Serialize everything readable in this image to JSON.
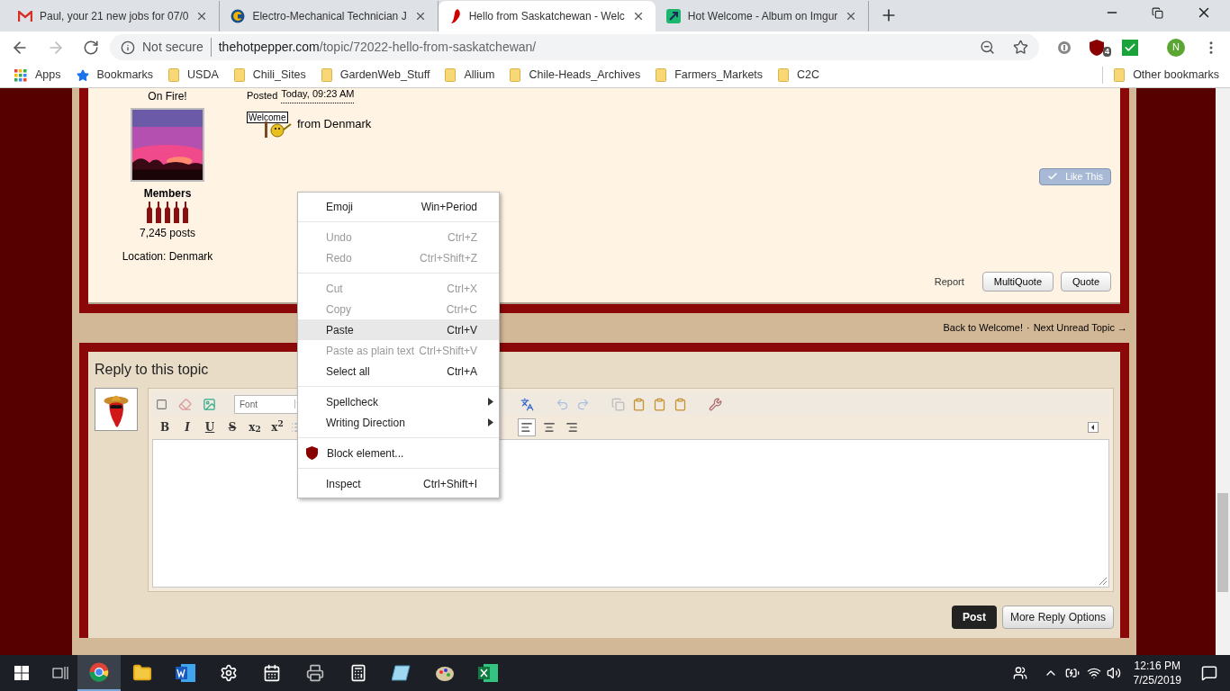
{
  "browser": {
    "tabs": [
      {
        "title": "Paul, your 21 new jobs for 07/0",
        "selected": false
      },
      {
        "title": "Electro-Mechanical Technician J",
        "selected": false
      },
      {
        "title": "Hello from Saskatchewan - Welc",
        "selected": true
      },
      {
        "title": "Hot Welcome - Album on Imgur",
        "selected": false
      }
    ],
    "security": "Not secure",
    "host": "thehotpepper.com",
    "path": "/topic/72022-hello-from-saskatchewan/",
    "extension_badge": "4",
    "profile": "N",
    "bookmarks": [
      {
        "label": "Apps",
        "kind": "apps"
      },
      {
        "label": "Bookmarks",
        "kind": "star"
      },
      {
        "label": "USDA",
        "kind": "folder"
      },
      {
        "label": "Chili_Sites",
        "kind": "folder"
      },
      {
        "label": "GardenWeb_Stuff",
        "kind": "folder"
      },
      {
        "label": "Allium",
        "kind": "folder"
      },
      {
        "label": "Chile-Heads_Archives",
        "kind": "folder"
      },
      {
        "label": "Farmers_Markets",
        "kind": "folder"
      },
      {
        "label": "C2C",
        "kind": "folder"
      }
    ],
    "other_bookmarks": "Other bookmarks"
  },
  "post": {
    "rank": "On Fire!",
    "group": "Members",
    "post_count": "7,245 posts",
    "location": "Location: Denmark",
    "posted_label": "Posted",
    "posted_time": "Today, 09:23 AM",
    "sign": "Welcome",
    "body": "from Denmark",
    "like": "Like This",
    "report": "Report",
    "multiquote": "MultiQuote",
    "quote": "Quote"
  },
  "topic_nav": {
    "back": "Back to Welcome!",
    "separator": "·",
    "next": "Next Unread Topic →"
  },
  "reply": {
    "title": "Reply to this topic",
    "font": "Font",
    "format_buttons": [
      "B",
      "I",
      "U",
      "S",
      "x$_{2}$",
      "x$^{2}$"
    ],
    "align": [
      {
        "selected": true
      },
      {
        "selected": false
      },
      {
        "selected": false
      }
    ],
    "post": "Post",
    "more": "More Reply Options"
  },
  "context_menu": [
    {
      "kind": "item",
      "label": "Emoji",
      "shortcut": "Win+Period",
      "disabled": false,
      "selected": false
    },
    {
      "kind": "separator"
    },
    {
      "kind": "item",
      "label": "Undo",
      "shortcut": "Ctrl+Z",
      "disabled": true,
      "selected": false
    },
    {
      "kind": "item",
      "label": "Redo",
      "shortcut": "Ctrl+Shift+Z",
      "disabled": true,
      "selected": false
    },
    {
      "kind": "separator"
    },
    {
      "kind": "item",
      "label": "Cut",
      "shortcut": "Ctrl+X",
      "disabled": true,
      "selected": false
    },
    {
      "kind": "item",
      "label": "Copy",
      "shortcut": "Ctrl+C",
      "disabled": true,
      "selected": false
    },
    {
      "kind": "item",
      "label": "Paste",
      "shortcut": "Ctrl+V",
      "disabled": false,
      "selected": true
    },
    {
      "kind": "item",
      "label": "Paste as plain text",
      "shortcut": "Ctrl+Shift+V",
      "disabled": true,
      "selected": false
    },
    {
      "kind": "item",
      "label": "Select all",
      "shortcut": "Ctrl+A",
      "disabled": false,
      "selected": false
    },
    {
      "kind": "separator"
    },
    {
      "kind": "submenu",
      "label": "Spellcheck"
    },
    {
      "kind": "submenu",
      "label": "Writing Direction"
    },
    {
      "kind": "separator"
    },
    {
      "kind": "extension",
      "label": "Block element..."
    },
    {
      "kind": "separator"
    },
    {
      "kind": "item",
      "label": "Inspect",
      "shortcut": "Ctrl+Shift+I",
      "disabled": false,
      "selected": false
    }
  ],
  "taskbar": {
    "apps": [
      {
        "selected": true
      },
      {
        "selected": false
      },
      {
        "selected": false
      },
      {
        "selected": false
      },
      {
        "selected": false
      },
      {
        "selected": false
      },
      {
        "selected": false
      },
      {
        "selected": false
      },
      {
        "selected": false
      },
      {
        "selected": false
      }
    ],
    "time": "12:16 PM",
    "date": "7/25/2019"
  }
}
